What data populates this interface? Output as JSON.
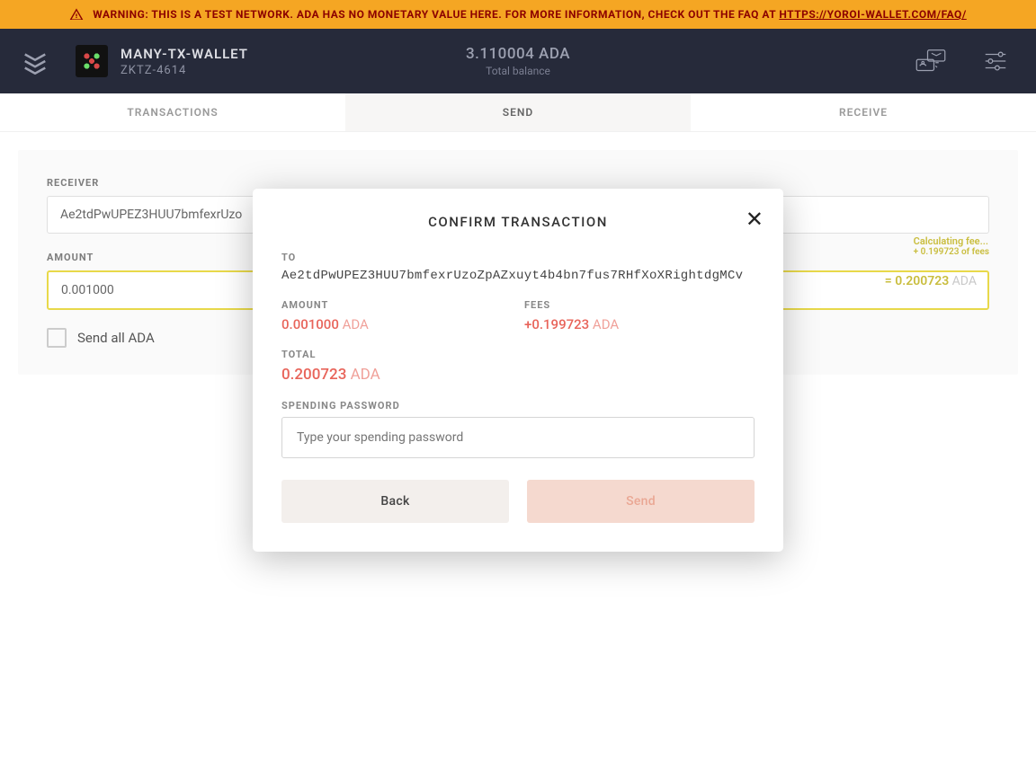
{
  "warning": {
    "text_prefix": "WARNING: THIS IS A TEST NETWORK. ADA HAS NO MONETARY VALUE HERE. FOR MORE INFORMATION, CHECK OUT THE FAQ AT ",
    "link_text": "HTTPS://YOROI-WALLET.COM/FAQ/"
  },
  "header": {
    "wallet_name": "MANY-TX-WALLET",
    "wallet_sub": "ZKTZ-4614",
    "balance": "3.110004 ADA",
    "balance_label": "Total balance"
  },
  "tabs": {
    "transactions": "TRANSACTIONS",
    "send": "SEND",
    "receive": "RECEIVE"
  },
  "form": {
    "receiver_label": "RECEIVER",
    "receiver_value": "Ae2tdPwUPEZ3HUU7bmfexrUzo",
    "amount_label": "AMOUNT",
    "amount_value": "0.001000",
    "fee_hint_line1": "Calculating fee...",
    "fee_hint_line2": "+ 0.199723 of fees",
    "equals_value": "= 0.200723",
    "equals_unit": " ADA",
    "send_all_label": "Send all ADA"
  },
  "modal": {
    "title": "CONFIRM TRANSACTION",
    "to_label": "TO",
    "to_value": "Ae2tdPwUPEZ3HUU7bmfexrUzoZpAZxuyt4b4bn7fus7RHfXoXRightdgMCv",
    "amount_label": "AMOUNT",
    "amount_value": "0.001000",
    "amount_unit": " ADA",
    "fees_label": "FEES",
    "fees_value": "+0.199723",
    "fees_unit": " ADA",
    "total_label": "TOTAL",
    "total_value": "0.200723",
    "total_unit": " ADA",
    "pw_label": "SPENDING PASSWORD",
    "pw_placeholder": "Type your spending password",
    "back_label": "Back",
    "send_label": "Send"
  }
}
